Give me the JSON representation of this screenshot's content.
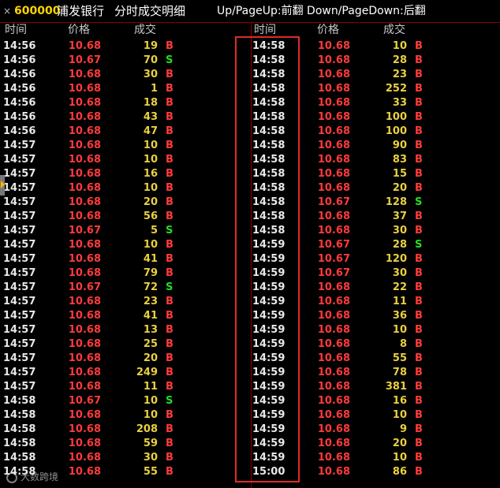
{
  "header": {
    "close": "×",
    "code": "600000",
    "name": "浦发银行",
    "title": "分时成交明细",
    "hint": "Up/PageUp:前翻 Down/PageDown:后翻"
  },
  "columns": {
    "time": "时间",
    "price": "价格",
    "volume": "成交"
  },
  "colors": {
    "buy": "#ff3b3b",
    "sell": "#22dd22",
    "volume": "#e8d040",
    "divider": "#8a0000",
    "highlight": "#e02a2a"
  },
  "watermark": "大数跨境",
  "left_rows": [
    {
      "time": "14:56",
      "price": "10.68",
      "vol": "19",
      "side": "B"
    },
    {
      "time": "14:56",
      "price": "10.67",
      "vol": "70",
      "side": "S"
    },
    {
      "time": "14:56",
      "price": "10.68",
      "vol": "30",
      "side": "B"
    },
    {
      "time": "14:56",
      "price": "10.68",
      "vol": "1",
      "side": "B"
    },
    {
      "time": "14:56",
      "price": "10.68",
      "vol": "18",
      "side": "B"
    },
    {
      "time": "14:56",
      "price": "10.68",
      "vol": "43",
      "side": "B"
    },
    {
      "time": "14:56",
      "price": "10.68",
      "vol": "47",
      "side": "B"
    },
    {
      "time": "14:57",
      "price": "10.68",
      "vol": "10",
      "side": "B"
    },
    {
      "time": "14:57",
      "price": "10.68",
      "vol": "10",
      "side": "B"
    },
    {
      "time": "14:57",
      "price": "10.68",
      "vol": "16",
      "side": "B"
    },
    {
      "time": "14:57",
      "price": "10.68",
      "vol": "10",
      "side": "B"
    },
    {
      "time": "14:57",
      "price": "10.68",
      "vol": "20",
      "side": "B"
    },
    {
      "time": "14:57",
      "price": "10.68",
      "vol": "56",
      "side": "B"
    },
    {
      "time": "14:57",
      "price": "10.67",
      "vol": "5",
      "side": "S"
    },
    {
      "time": "14:57",
      "price": "10.68",
      "vol": "10",
      "side": "B"
    },
    {
      "time": "14:57",
      "price": "10.68",
      "vol": "41",
      "side": "B"
    },
    {
      "time": "14:57",
      "price": "10.68",
      "vol": "79",
      "side": "B"
    },
    {
      "time": "14:57",
      "price": "10.67",
      "vol": "72",
      "side": "S"
    },
    {
      "time": "14:57",
      "price": "10.68",
      "vol": "23",
      "side": "B"
    },
    {
      "time": "14:57",
      "price": "10.68",
      "vol": "41",
      "side": "B"
    },
    {
      "time": "14:57",
      "price": "10.68",
      "vol": "13",
      "side": "B"
    },
    {
      "time": "14:57",
      "price": "10.68",
      "vol": "25",
      "side": "B"
    },
    {
      "time": "14:57",
      "price": "10.68",
      "vol": "20",
      "side": "B"
    },
    {
      "time": "14:57",
      "price": "10.68",
      "vol": "249",
      "side": "B"
    },
    {
      "time": "14:57",
      "price": "10.68",
      "vol": "11",
      "side": "B"
    },
    {
      "time": "14:58",
      "price": "10.67",
      "vol": "10",
      "side": "S"
    },
    {
      "time": "14:58",
      "price": "10.68",
      "vol": "10",
      "side": "B"
    },
    {
      "time": "14:58",
      "price": "10.68",
      "vol": "208",
      "side": "B"
    },
    {
      "time": "14:58",
      "price": "10.68",
      "vol": "59",
      "side": "B"
    },
    {
      "time": "14:58",
      "price": "10.68",
      "vol": "30",
      "side": "B"
    },
    {
      "time": "14:58",
      "price": "10.68",
      "vol": "55",
      "side": "B"
    }
  ],
  "right_rows": [
    {
      "time": "14:58",
      "price": "10.68",
      "vol": "10",
      "side": "B"
    },
    {
      "time": "14:58",
      "price": "10.68",
      "vol": "28",
      "side": "B"
    },
    {
      "time": "14:58",
      "price": "10.68",
      "vol": "23",
      "side": "B"
    },
    {
      "time": "14:58",
      "price": "10.68",
      "vol": "252",
      "side": "B"
    },
    {
      "time": "14:58",
      "price": "10.68",
      "vol": "33",
      "side": "B"
    },
    {
      "time": "14:58",
      "price": "10.68",
      "vol": "100",
      "side": "B"
    },
    {
      "time": "14:58",
      "price": "10.68",
      "vol": "100",
      "side": "B"
    },
    {
      "time": "14:58",
      "price": "10.68",
      "vol": "90",
      "side": "B"
    },
    {
      "time": "14:58",
      "price": "10.68",
      "vol": "83",
      "side": "B"
    },
    {
      "time": "14:58",
      "price": "10.68",
      "vol": "15",
      "side": "B"
    },
    {
      "time": "14:58",
      "price": "10.68",
      "vol": "20",
      "side": "B"
    },
    {
      "time": "14:58",
      "price": "10.67",
      "vol": "128",
      "side": "S"
    },
    {
      "time": "14:58",
      "price": "10.68",
      "vol": "37",
      "side": "B"
    },
    {
      "time": "14:58",
      "price": "10.68",
      "vol": "30",
      "side": "B"
    },
    {
      "time": "14:59",
      "price": "10.67",
      "vol": "28",
      "side": "S"
    },
    {
      "time": "14:59",
      "price": "10.67",
      "vol": "120",
      "side": "B"
    },
    {
      "time": "14:59",
      "price": "10.67",
      "vol": "30",
      "side": "B"
    },
    {
      "time": "14:59",
      "price": "10.68",
      "vol": "22",
      "side": "B"
    },
    {
      "time": "14:59",
      "price": "10.68",
      "vol": "11",
      "side": "B"
    },
    {
      "time": "14:59",
      "price": "10.68",
      "vol": "36",
      "side": "B"
    },
    {
      "time": "14:59",
      "price": "10.68",
      "vol": "10",
      "side": "B"
    },
    {
      "time": "14:59",
      "price": "10.68",
      "vol": "8",
      "side": "B"
    },
    {
      "time": "14:59",
      "price": "10.68",
      "vol": "55",
      "side": "B"
    },
    {
      "time": "14:59",
      "price": "10.68",
      "vol": "78",
      "side": "B"
    },
    {
      "time": "14:59",
      "price": "10.68",
      "vol": "381",
      "side": "B"
    },
    {
      "time": "14:59",
      "price": "10.68",
      "vol": "16",
      "side": "B"
    },
    {
      "time": "14:59",
      "price": "10.68",
      "vol": "10",
      "side": "B"
    },
    {
      "time": "14:59",
      "price": "10.68",
      "vol": "9",
      "side": "B"
    },
    {
      "time": "14:59",
      "price": "10.68",
      "vol": "20",
      "side": "B"
    },
    {
      "time": "14:59",
      "price": "10.68",
      "vol": "10",
      "side": "B"
    },
    {
      "time": "15:00",
      "price": "10.68",
      "vol": "86",
      "side": "B"
    }
  ]
}
